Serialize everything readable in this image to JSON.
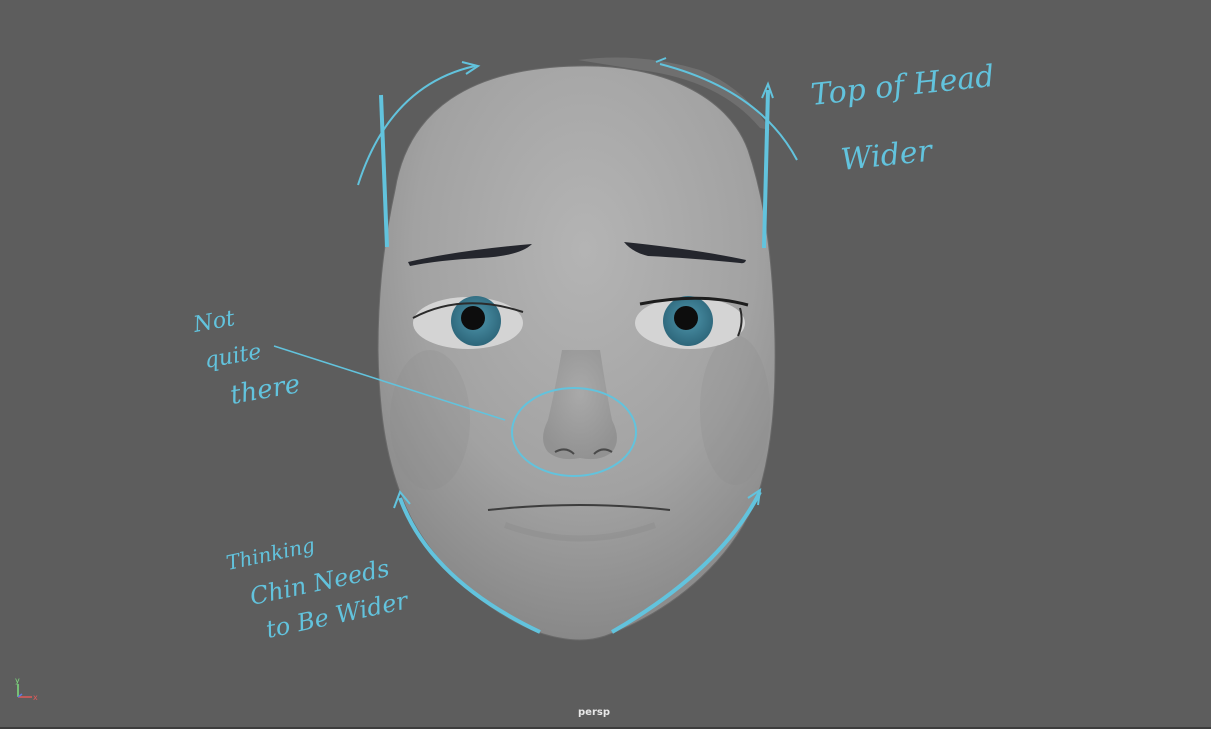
{
  "viewport": {
    "camera_label": "persp",
    "background_color": "#5d5d5d",
    "annotation_color": "#62c3dd"
  },
  "axis_gizmo": {
    "y_label": "y",
    "x_label": "x"
  },
  "annotations": {
    "top_note_line1": "Top of Head",
    "top_note_line2": "Wider",
    "nose_note_line1": "Not",
    "nose_note_line2": "quite",
    "nose_note_line3": "there",
    "chin_note_line1": "Thinking",
    "chin_note_line2": "Chin Needs",
    "chin_note_line3": "to Be Wider"
  },
  "model": {
    "eye_color": "#3d7f96"
  }
}
